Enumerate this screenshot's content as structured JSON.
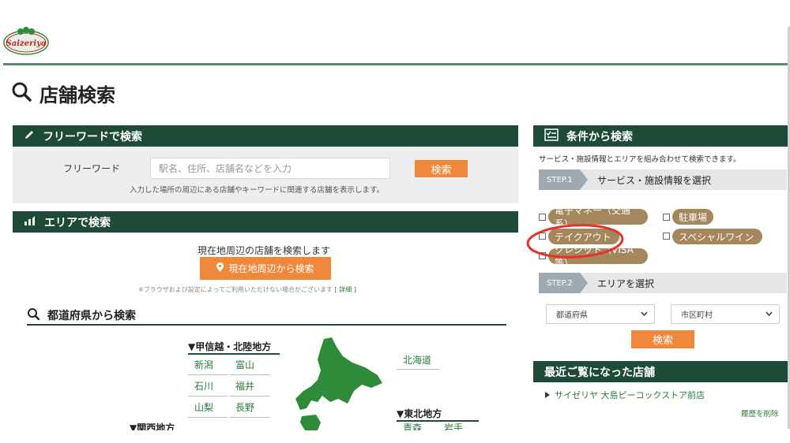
{
  "header": {
    "logo_text": "Saizeriya"
  },
  "page_title": "店舗検索",
  "freeword": {
    "heading": "フリーワードで検索",
    "label": "フリーワード",
    "placeholder": "駅名、住所、店舗名などを入力",
    "button": "検索",
    "note": "入力した場所の周辺にある店舗やキーワードに関連する店舗を表示します。"
  },
  "area": {
    "heading": "エリアで検索",
    "nearby_text": "現在地周辺の店舗を検索します",
    "nearby_button": "現在地周辺から検索",
    "browser_note": "※ブラウザおよび設定によってご利用いただけない場合がございます",
    "detail_link": "詳細",
    "prefecture_heading": "都道府県から検索",
    "regions": [
      {
        "name": "▼甲信越・北陸地方",
        "prefs": [
          "新潟",
          "富山",
          "石川",
          "福井",
          "山梨",
          "長野"
        ]
      },
      {
        "name": "▼関西地方",
        "prefs": []
      },
      {
        "name": "北海道",
        "prefs": []
      },
      {
        "name": "▼東北地方",
        "prefs": [
          "青森",
          "岩手"
        ]
      }
    ]
  },
  "conditions": {
    "heading": "条件から検索",
    "description": "サービス・施設情報とエリアを組み合わせて検索できます。",
    "step1_badge": "STEP.1",
    "step1_text": "サービス・施設情報を選択",
    "tags": [
      "電子マネー（交通系）",
      "駐車場",
      "テイクアウト",
      "スペシャルワイン",
      "クレジット（VISA等）"
    ],
    "step2_badge": "STEP.2",
    "step2_text": "エリアを選択",
    "prefecture_select": "都道府県",
    "city_select": "市区町村",
    "search_button": "検索"
  },
  "recent": {
    "heading": "最近ご覧になった店舗",
    "store": "サイゼリヤ 大島ピーコックストア前店",
    "clear_link": "履歴を削除"
  },
  "colors": {
    "header_bar": "#1e4a38",
    "button_orange": "#f0883c",
    "tag_brown": "#a5875d",
    "annotation_red": "#e8302a",
    "map_green": "#2e8b3a"
  }
}
